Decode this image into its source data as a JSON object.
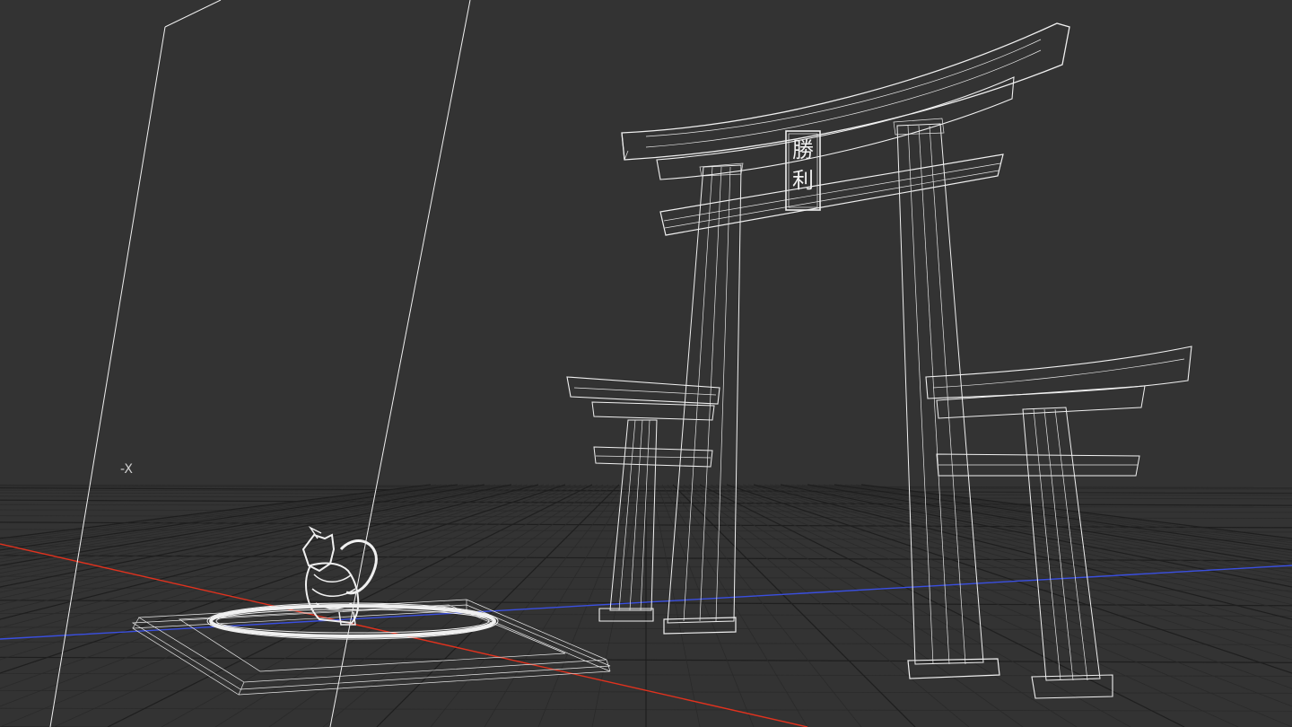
{
  "viewport": {
    "background_color": "#333333",
    "axis_label": "-X",
    "x_axis_color": "#e0321e",
    "z_axis_color": "#3a4fe0",
    "wire_color": "#f0f0f0",
    "grid_color": "#1f1f1f"
  },
  "scene": {
    "torii_plaque_text": [
      "勝",
      "利"
    ],
    "objects": [
      "camera-frame",
      "main-torii-gate",
      "small-torii-gate-left",
      "small-torii-gate-right",
      "character-figure",
      "ring",
      "platform-base"
    ]
  }
}
